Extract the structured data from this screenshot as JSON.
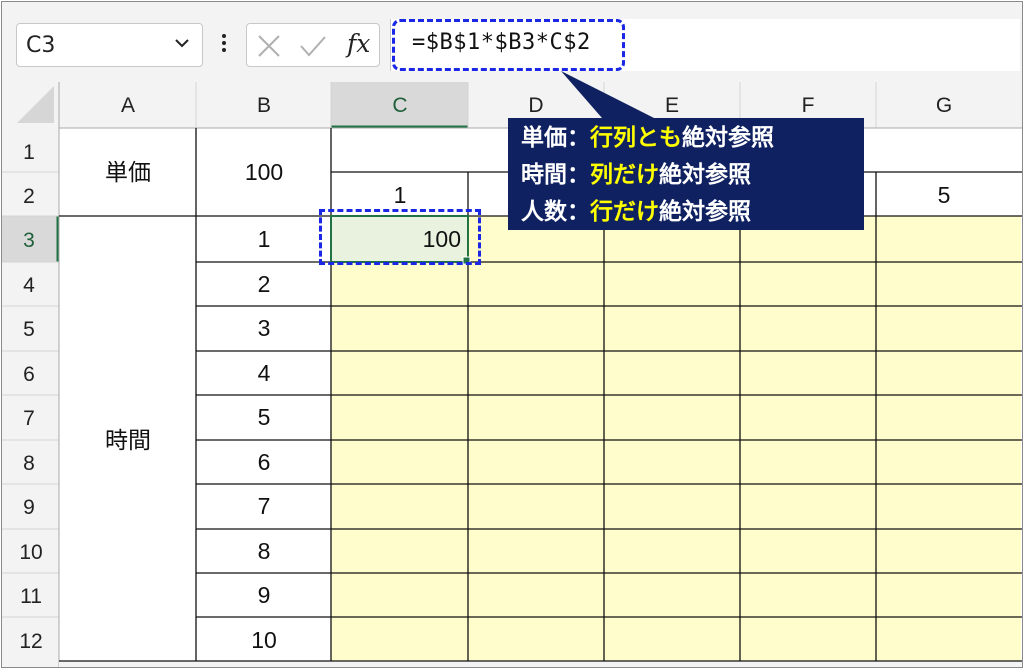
{
  "name_box": {
    "value": "C3"
  },
  "formula_bar": {
    "formula": "=$B$1*$B3*C$2"
  },
  "columns": [
    "A",
    "B",
    "C",
    "D",
    "E",
    "F",
    "G"
  ],
  "rows": [
    "1",
    "2",
    "3",
    "4",
    "5",
    "6",
    "7",
    "8",
    "9",
    "10",
    "11",
    "12"
  ],
  "cells": {
    "A1": "単価",
    "B1": "100",
    "C2": "1",
    "G2": "5",
    "A3": "時間",
    "B3": "1",
    "B4": "2",
    "B5": "3",
    "B6": "4",
    "B7": "5",
    "B8": "6",
    "B9": "7",
    "B10": "8",
    "B11": "9",
    "B12": "10",
    "C3": "100"
  },
  "callout": {
    "line1": {
      "label": "単価",
      "sep": "：",
      "hl": "行列とも",
      "rest": "絶対参照"
    },
    "line2": {
      "label": "時間",
      "sep": "：",
      "hl": "列だけ",
      "rest": "絶対参照"
    },
    "line3": {
      "label": "人数",
      "sep": "：",
      "hl": "行だけ",
      "rest": "絶対参照"
    }
  },
  "colors": {
    "input_fill": "#fffdcc",
    "active_accent": "#217346",
    "annotation_blue": "#1a28e6",
    "callout_bg": "#0f2161",
    "highlight_text": "#ffff00"
  }
}
